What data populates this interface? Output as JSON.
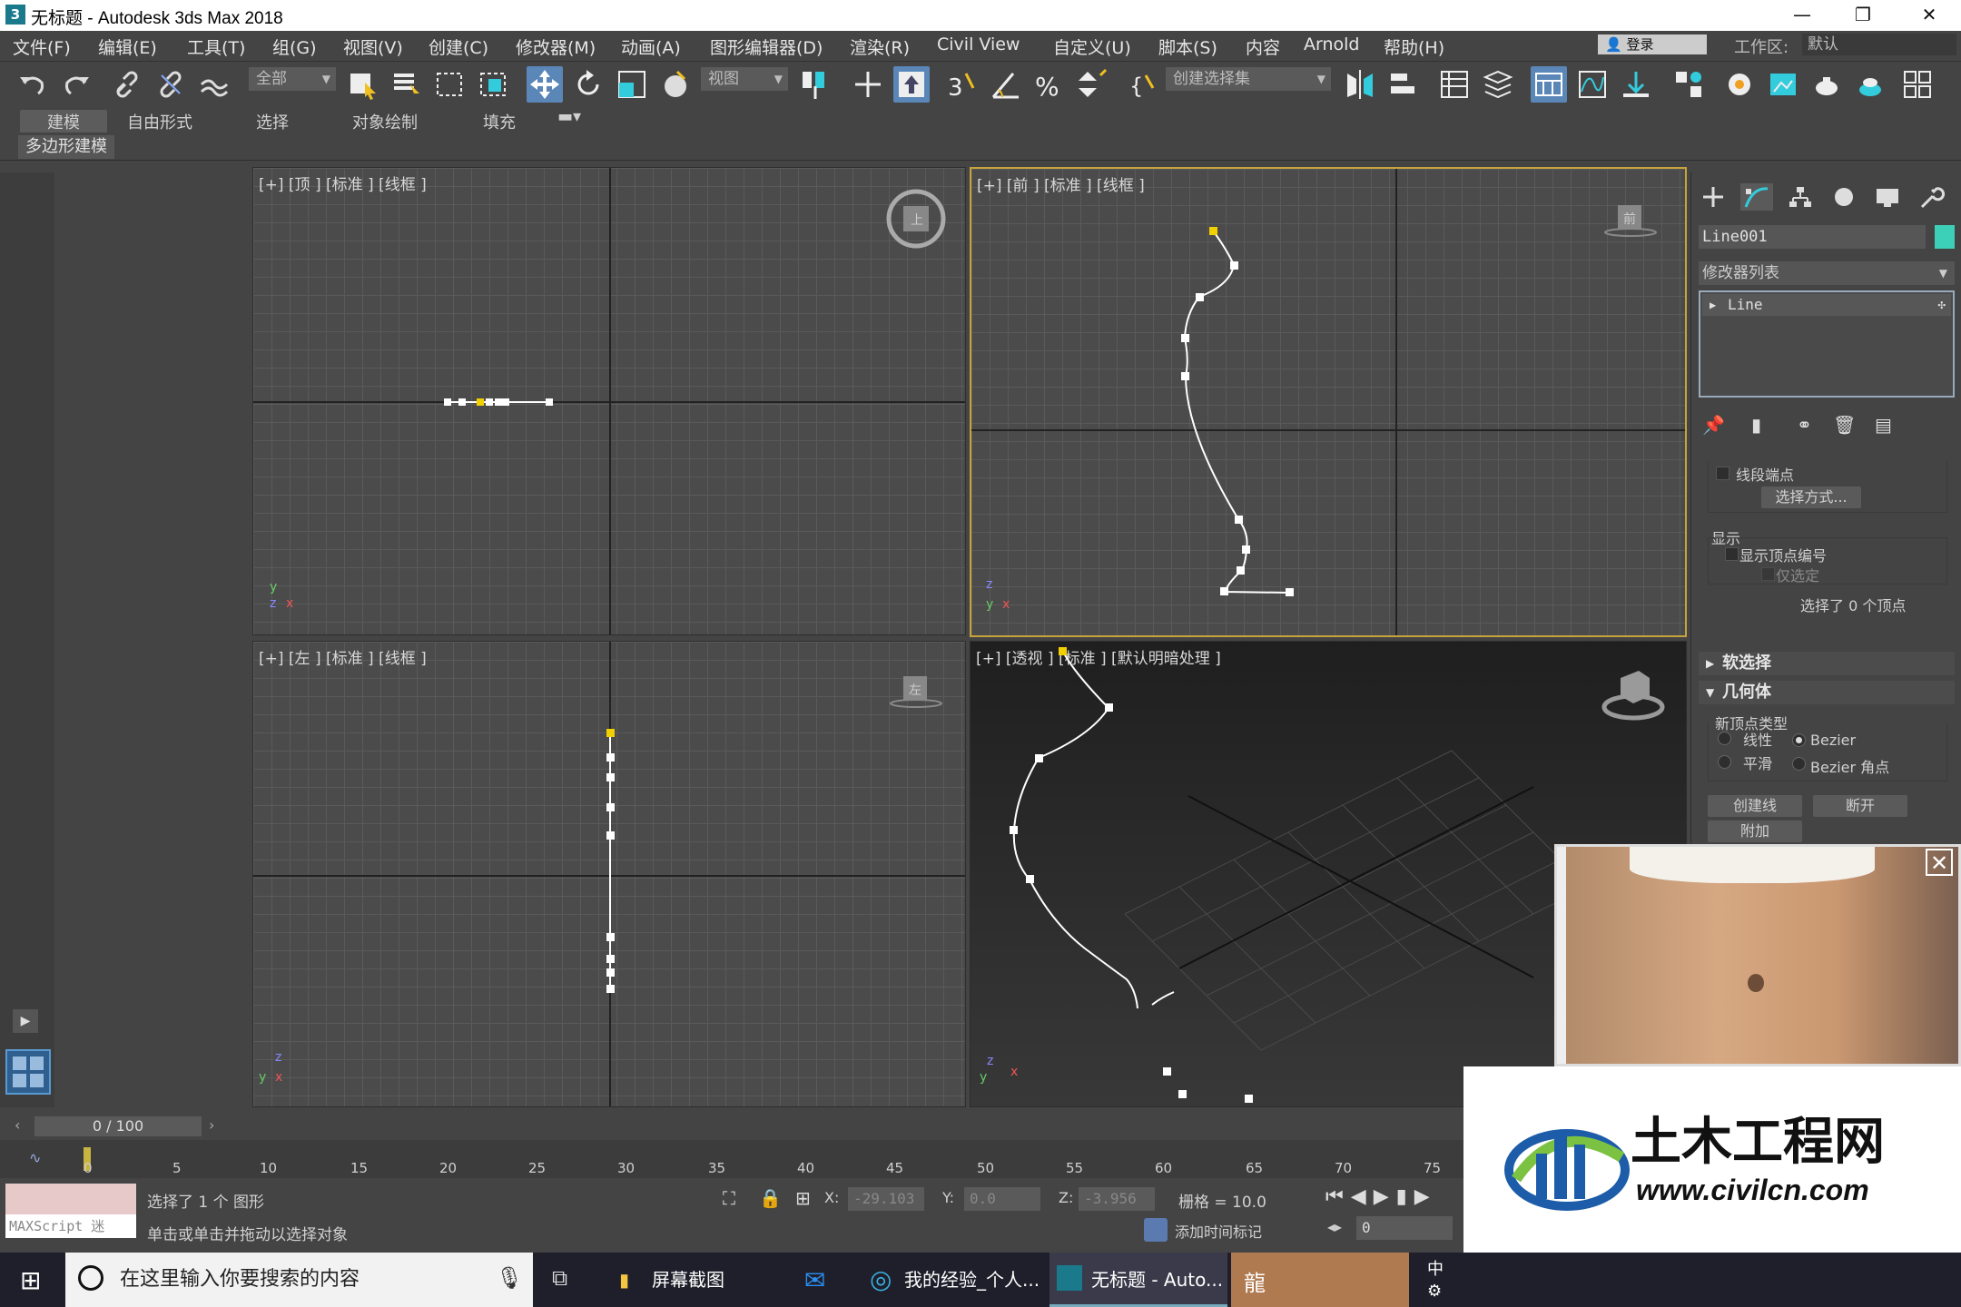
{
  "window": {
    "title": "无标题 - Autodesk 3ds Max 2018",
    "logo_text": "3",
    "controls": [
      "—",
      "❐",
      "✕"
    ]
  },
  "menu": [
    "文件(F)",
    "编辑(E)",
    "工具(T)",
    "组(G)",
    "视图(V)",
    "创建(C)",
    "修改器(M)",
    "动画(A)",
    "图形编辑器(D)",
    "渲染(R)",
    "Civil View",
    "自定义(U)",
    "脚本(S)",
    "内容",
    "Arnold",
    "帮助(H)"
  ],
  "login": "登录",
  "workspace": {
    "label": "工作区:",
    "value": "默认"
  },
  "toolbar": {
    "filter_dropdown": "全部",
    "refcoord_dropdown": "视图",
    "selection_set_dropdown": "创建选择集"
  },
  "ribbon": {
    "tabs": [
      "建模",
      "自由形式",
      "选择",
      "对象绘制",
      "填充"
    ],
    "active": "建模",
    "sub_label": "多边形建模"
  },
  "viewports": {
    "top": "[+] [顶 ] [标准 ] [线框 ]",
    "front": "[+] [前 ] [标准 ] [线框 ]",
    "left": "[+] [左 ] [标准 ] [线框 ]",
    "persp": "[+] [透视 ] [标准 ] [默认明暗处理 ]",
    "front_cube": "前",
    "left_cube": "左",
    "top_cube": "上"
  },
  "cmdpanel": {
    "object_name": "Line001",
    "object_color": "#3dd0b8",
    "modifier_list": "修改器列表",
    "stack_item": "Line",
    "seg_endpoint": "线段端点",
    "select_by": "选择方式...",
    "display": "显示",
    "show_vertex_numbers": "显示顶点编号",
    "only_selected": "仅选定",
    "selection_info": "选择了 0 个顶点",
    "soft_selection": "软选择",
    "geometry": "几何体",
    "new_vertex_type": "新顶点类型",
    "linear": "线性",
    "bezier": "Bezier",
    "smooth": "平滑",
    "bezier_corner": "Bezier 角点",
    "create_line": "创建线",
    "break": "断开",
    "attach": "附加"
  },
  "timeline": {
    "frame": "0 / 100",
    "ticks": [
      "0",
      "5",
      "10",
      "15",
      "20",
      "25",
      "30",
      "35",
      "40",
      "45",
      "50",
      "55",
      "60",
      "65",
      "70",
      "75"
    ]
  },
  "status": {
    "selected": "选择了 1 个 图形",
    "hint": "单击或单击并拖动以选择对象",
    "maxscript": "MAXScript 迷",
    "x_label": "X:",
    "x_value": "-29.103",
    "y_label": "Y:",
    "y_value": "0.0",
    "z_label": "Z:",
    "z_value": "-3.956",
    "grid": "栅格 = 10.0",
    "add_time_tag": "添加时间标记",
    "frame_spinner": "0"
  },
  "taskbar": {
    "search_placeholder": "在这里输入你要搜索的内容",
    "items": [
      "屏幕截图",
      "我的经验_个人...",
      "无标题 - Auto..."
    ],
    "tray_ime": "中"
  },
  "watermark": {
    "title": "土木工程网",
    "url": "www.civilcn.com"
  }
}
